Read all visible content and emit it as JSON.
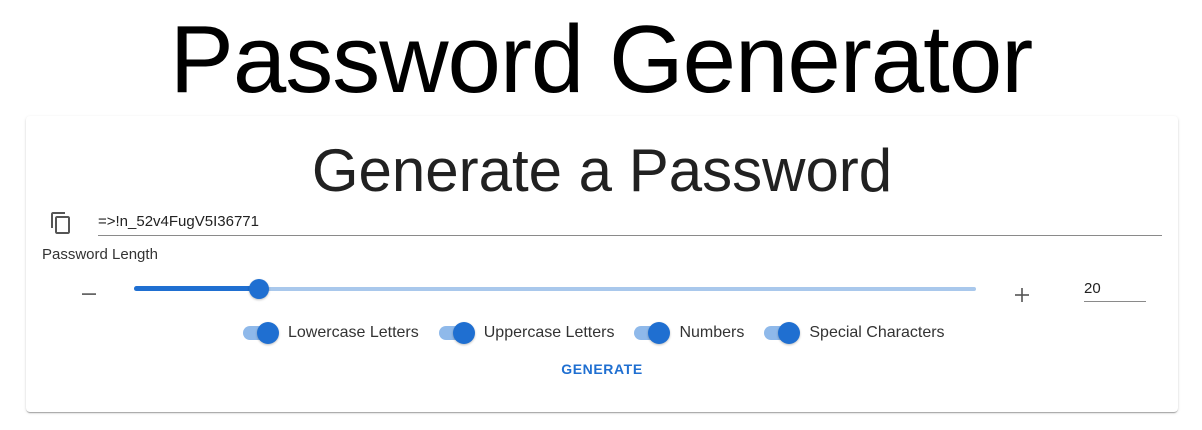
{
  "header": {
    "title": "Password Generator"
  },
  "card": {
    "title": "Generate a Password",
    "password": {
      "value": "=>!n_52v4FugV5I36771"
    },
    "length": {
      "label": "Password Length",
      "value": "20",
      "min": 0,
      "max": 100,
      "fraction": 0.149
    },
    "options": [
      {
        "label": "Lowercase Letters",
        "checked": true
      },
      {
        "label": "Uppercase Letters",
        "checked": true
      },
      {
        "label": "Numbers",
        "checked": true
      },
      {
        "label": "Special Characters",
        "checked": true
      }
    ],
    "generate_label": "GENERATE"
  },
  "icons": {
    "copy": "copy-icon",
    "minus": "minus-icon",
    "plus": "plus-icon"
  },
  "colors": {
    "accent": "#1f6fd1",
    "accent_light": "#a9c8ec",
    "switch_track": "#8fb9ea"
  }
}
